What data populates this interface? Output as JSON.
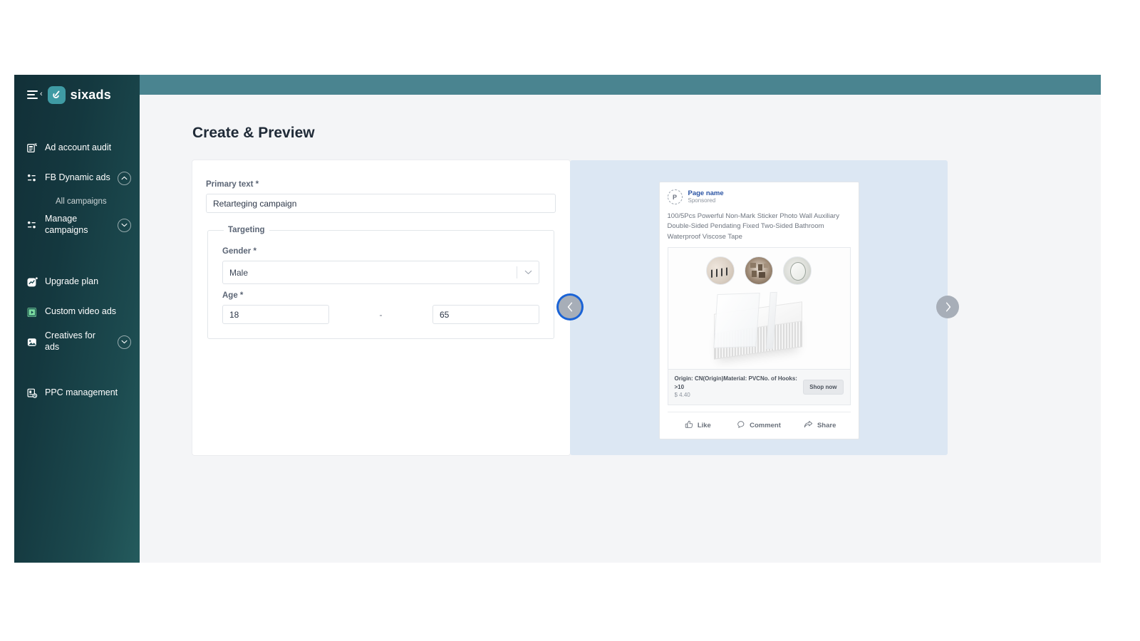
{
  "brand": {
    "name": "sixads",
    "logo_glyph": "6"
  },
  "sidebar": {
    "items": [
      {
        "label": "Ad account audit",
        "icon": "audit-icon"
      },
      {
        "label": "FB Dynamic ads",
        "icon": "dynamic-ads-icon",
        "toggle": "chevron-up"
      },
      {
        "label": "All campaigns",
        "sub": true
      },
      {
        "label": "Manage campaigns",
        "icon": "manage-campaigns-icon",
        "toggle": "chevron-down"
      },
      {
        "label": "Upgrade plan",
        "icon": "upgrade-plan-icon"
      },
      {
        "label": "Custom video ads",
        "icon": "video-ads-icon"
      },
      {
        "label": "Creatives for ads",
        "icon": "creatives-icon",
        "toggle": "chevron-down"
      },
      {
        "label": "PPC management",
        "icon": "ppc-management-icon"
      }
    ]
  },
  "header": {
    "title": "Create & Preview"
  },
  "form": {
    "primary_text": {
      "label": "Primary text *",
      "value": "Retarteging campaign",
      "placeholder": "Primary text"
    },
    "targeting": {
      "legend": "Targeting",
      "gender": {
        "label": "Gender *",
        "value": "Male"
      },
      "age": {
        "label": "Age *",
        "min": "18",
        "max": "65",
        "separator": "-"
      }
    }
  },
  "preview": {
    "prev_label": "‹",
    "next_label": "›",
    "ad": {
      "avatar_letter": "P",
      "page_name": "Page name",
      "sponsored": "Sponsored",
      "copy": "100/5Pcs Powerful Non-Mark Sticker Photo Wall Auxiliary Double-Sided Pendating Fixed Two-Sided Bathroom Waterproof Viscose Tape",
      "meta_title": "Origin: CN(Origin)Material: PVCNo. of Hooks: >10",
      "price": "$ 4.40",
      "cta": "Shop now",
      "actions": [
        {
          "label": "Like",
          "icon": "thumbs-up-icon"
        },
        {
          "label": "Comment",
          "icon": "comment-bubble-icon"
        },
        {
          "label": "Share",
          "icon": "share-arrow-icon"
        }
      ]
    }
  },
  "colors": {
    "sidebar_dark": "#123038",
    "sidebar_light": "#245b5d",
    "topbar_teal": "#4a8490",
    "preview_bg": "#dce7f3",
    "focus_ring": "#1a63d6",
    "page_name_blue": "#2a53a3",
    "video_green": "#7ddca1"
  }
}
